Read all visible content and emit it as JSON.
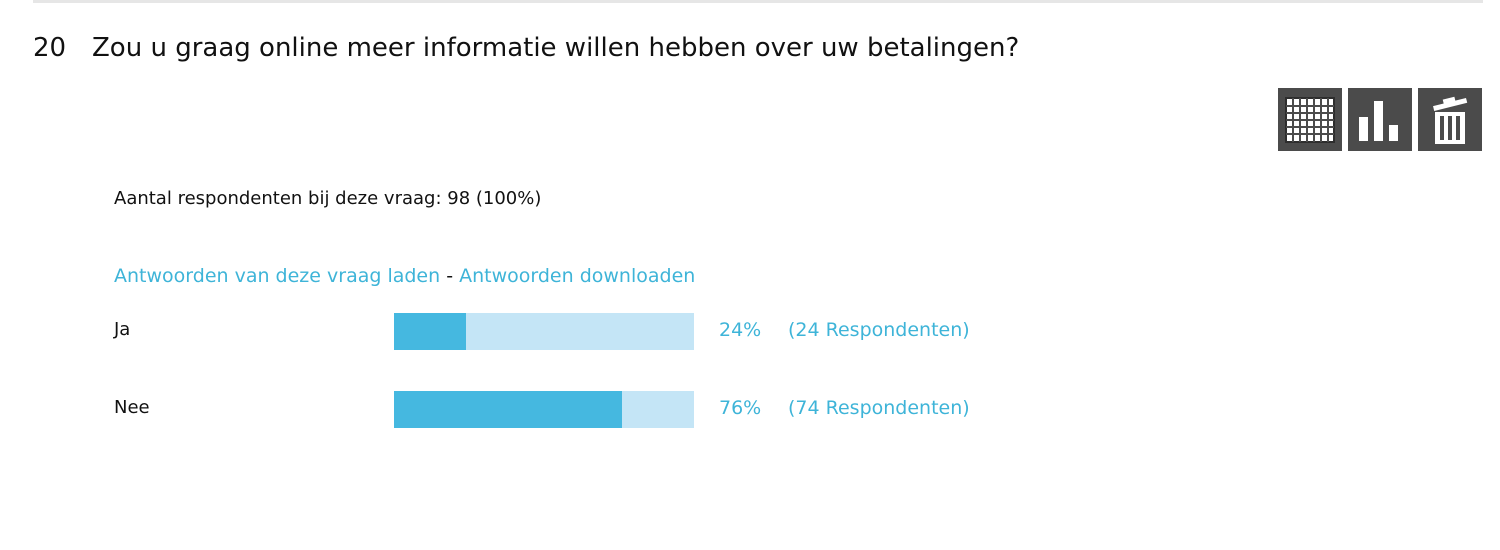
{
  "question": {
    "number": "20",
    "text": "Zou u graag online meer informatie willen hebben over uw betalingen?"
  },
  "toolbar": {
    "buttons": [
      {
        "icon": "table-icon"
      },
      {
        "icon": "bar-chart-icon"
      },
      {
        "icon": "trash-icon"
      }
    ]
  },
  "respondents_text": "Aantal respondenten bij deze vraag: 98 (100%)",
  "links": {
    "load_answers": "Antwoorden van deze vraag laden",
    "separator": " - ",
    "download_answers": "Antwoorden downloaden"
  },
  "colors": {
    "accent": "#3eb4d8",
    "bar_fill": "#45b8e0",
    "bar_track": "#c4e5f6",
    "toolbar": "#4b4b4b"
  },
  "answers": [
    {
      "label": "Ja",
      "percent": 24,
      "percent_text": "24%",
      "count_text": "(24 Respondenten)"
    },
    {
      "label": "Nee",
      "percent": 76,
      "percent_text": "76%",
      "count_text": "(74 Respondenten)"
    }
  ]
}
